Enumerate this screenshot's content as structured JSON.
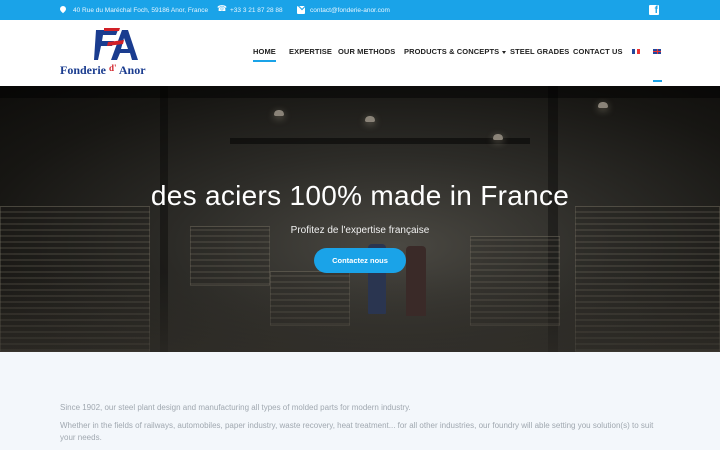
{
  "topbar": {
    "address": "40 Rue du Maréchal Foch, 59186 Anor, France",
    "phone": "+33 3 21 87 28 88",
    "email": "contact@fonderie-anor.com",
    "social_icon": "facebook-icon"
  },
  "logo": {
    "mark": "FA",
    "name": "Fonderie",
    "name_suffix": "d'",
    "name_end": "Anor"
  },
  "nav": {
    "items": [
      {
        "label": "HOME",
        "active": true
      },
      {
        "label": "EXPERTISE"
      },
      {
        "label": "OUR METHODS"
      },
      {
        "label": "PRODUCTS & CONCEPTS",
        "dropdown": true
      },
      {
        "label": "STEEL GRADES"
      },
      {
        "label": "CONTACT US"
      }
    ],
    "languages": [
      "fr",
      "en"
    ]
  },
  "hero": {
    "title": "des aciers 100% made in France",
    "subtitle": "Profitez de l'expertise française",
    "cta": "Contactez nous"
  },
  "intro": {
    "p1": "Since 1902, our steel plant design and manufacturing all types of molded parts for modern industry.",
    "p2": "Whether in the fields of railways, automobiles, paper industry, waste recovery, heat treatment... for all other industries, our foundry will able setting you solution(s) to suit your needs."
  },
  "colors": {
    "accent": "#1aa3e8",
    "logo_blue": "#1a3c8f",
    "logo_red": "#d12027"
  }
}
